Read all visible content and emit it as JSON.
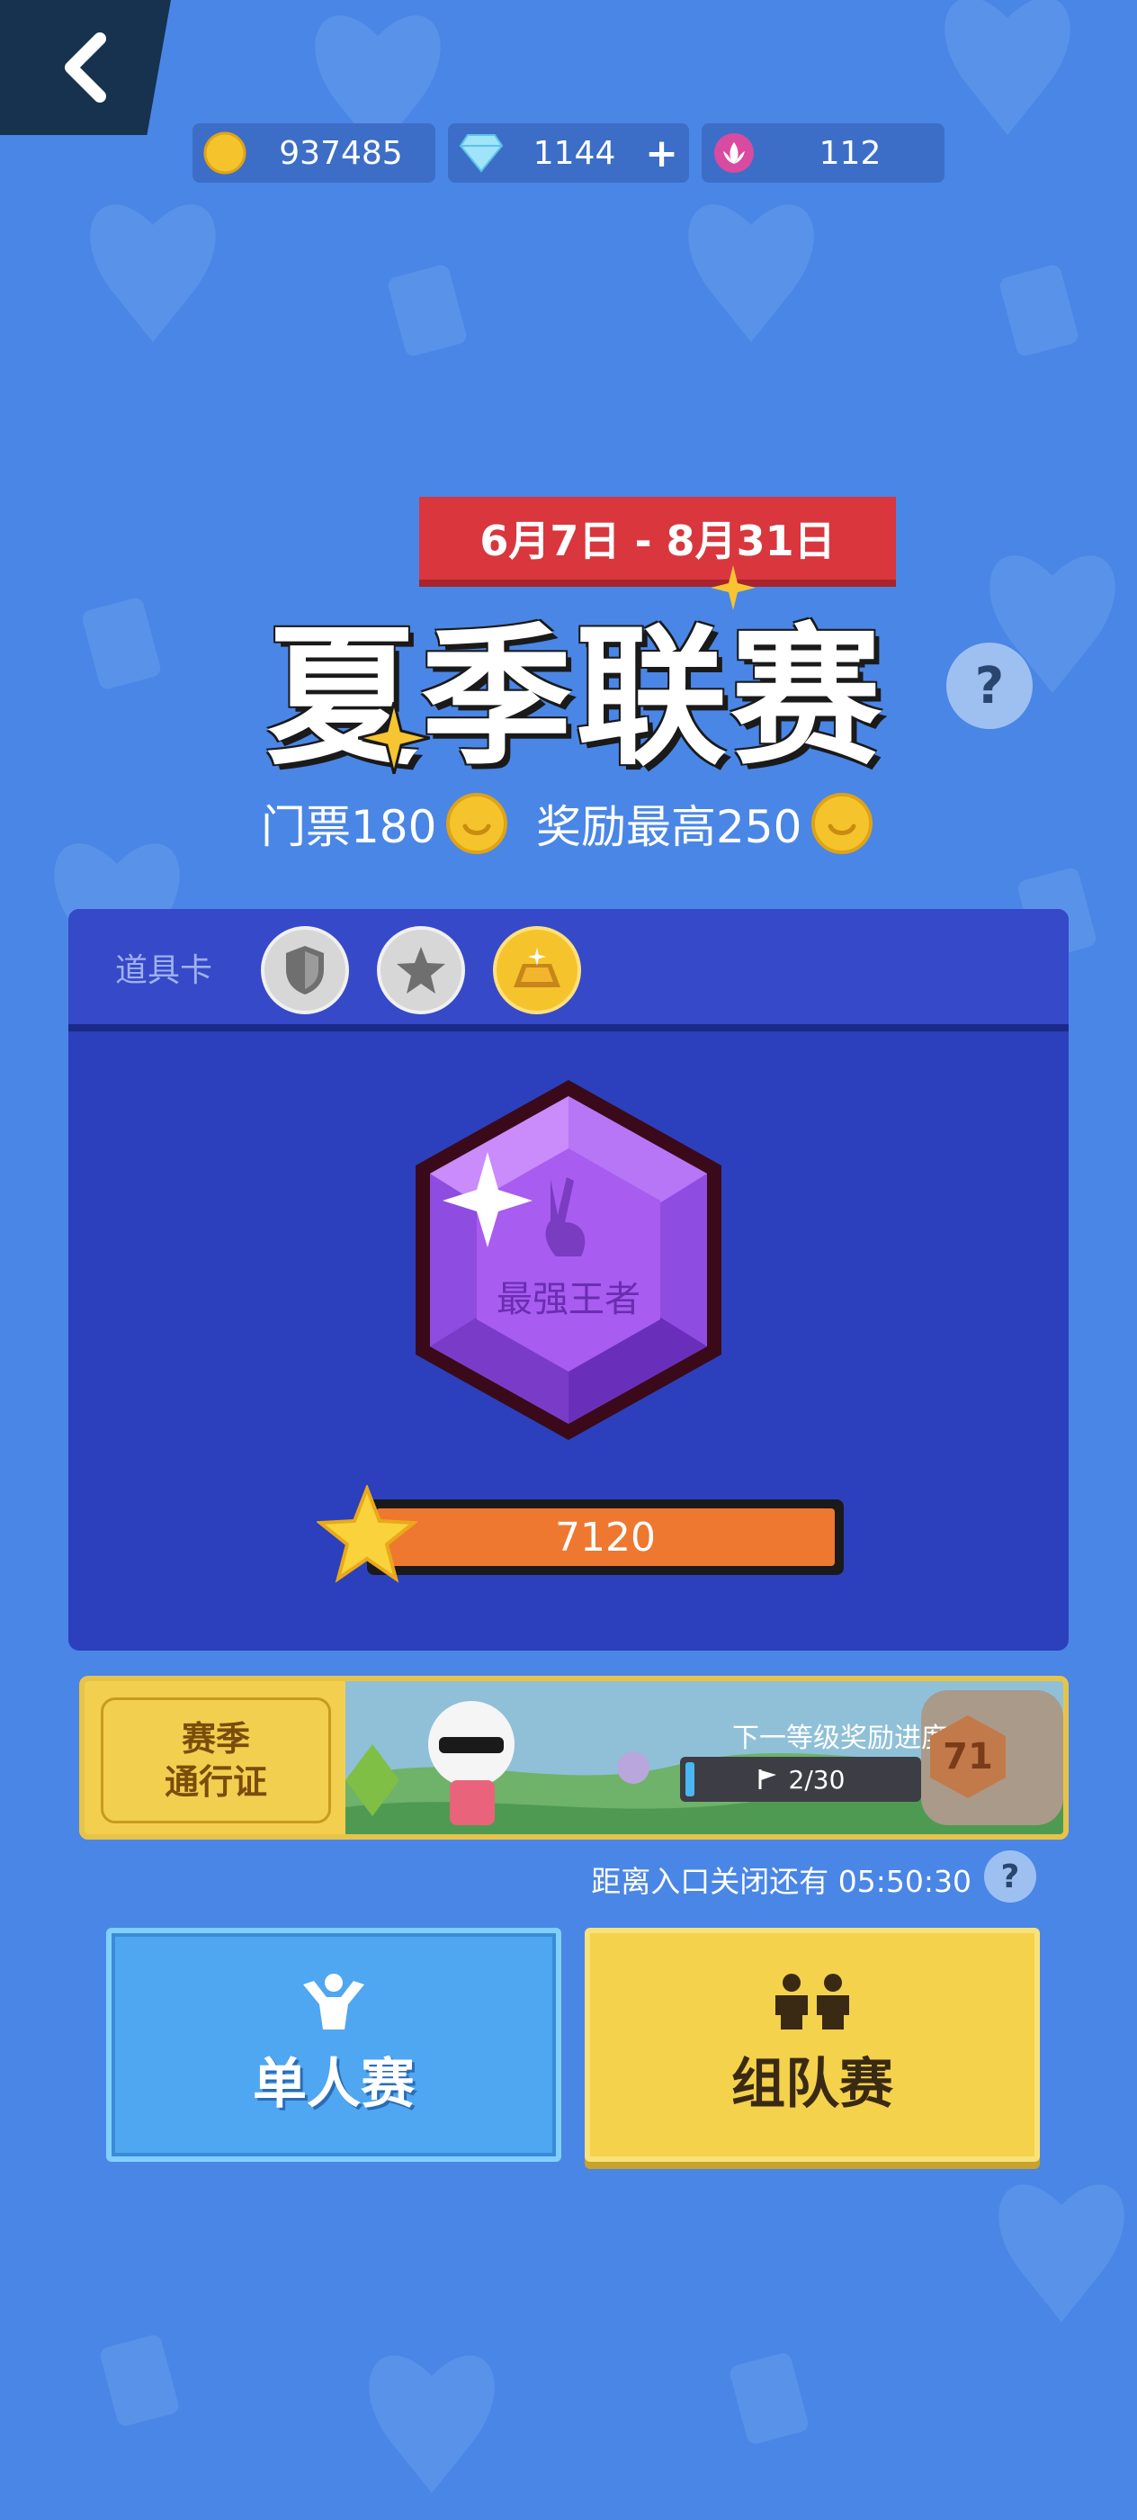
{
  "currency": {
    "coins": "937485",
    "gems": "1144",
    "gems_add": "+",
    "lotus": "112"
  },
  "event": {
    "date_range": "6月7日 - 8月31日",
    "title": "夏季联赛",
    "help": "?",
    "ticket": "门票180",
    "max_reward": "奖励最高250"
  },
  "panel": {
    "props_label": "道具卡",
    "props": [
      "shield-icon",
      "star-icon",
      "gold-bar-icon"
    ],
    "rank_name": "最强王者",
    "score": "7120"
  },
  "season_pass": {
    "label_line1": "赛季",
    "label_line2": "通行证",
    "progress_label": "下一等级奖励进度",
    "progress_text": "2/30",
    "progress_fraction": 0.0667,
    "level": "71"
  },
  "countdown": {
    "text": "距离入口关闭还有 05:50:30",
    "help": "?"
  },
  "modes": {
    "single": "单人赛",
    "team": "组队赛"
  },
  "colors": {
    "background": "#4a86e6",
    "panel": "#2c40bd",
    "banner": "#d9363e",
    "score": "#ee7830",
    "single_button": "#4fa6f1",
    "team_button": "#f5d24c",
    "rank_gem": "#a85cf0"
  }
}
